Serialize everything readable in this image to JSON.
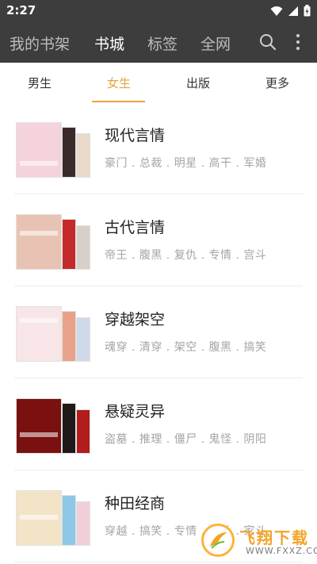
{
  "status_bar": {
    "time": "2:27"
  },
  "app_bar": {
    "tabs": [
      {
        "label": "我的书架",
        "active": false
      },
      {
        "label": "书城",
        "active": true
      },
      {
        "label": "标签",
        "active": false
      },
      {
        "label": "全网",
        "active": false
      }
    ],
    "actions": [
      "search-icon",
      "more-vert-icon"
    ]
  },
  "sub_tabs": [
    {
      "label": "男生",
      "active": false
    },
    {
      "label": "女生",
      "active": true
    },
    {
      "label": "出版",
      "active": false
    },
    {
      "label": "更多",
      "active": false
    }
  ],
  "categories": [
    {
      "title": "现代言情",
      "tags": "豪门 . 总裁 . 明星 . 高干 . 军婚",
      "cover_colors": [
        "#f4d3dc",
        "#3a2a2a",
        "#e9d9c9"
      ]
    },
    {
      "title": "古代言情",
      "tags": "帝王 . 腹黑 . 复仇 . 专情 . 宫斗",
      "cover_colors": [
        "#e8c3b3",
        "#c42a2a",
        "#d8d0c8"
      ]
    },
    {
      "title": "穿越架空",
      "tags": "魂穿 . 清穿 . 架空 . 腹黑 . 搞笑",
      "cover_colors": [
        "#f7e5e8",
        "#e9a28a",
        "#cfd9ea"
      ]
    },
    {
      "title": "悬疑灵异",
      "tags": "盗墓 . 推理 . 僵尸 . 鬼怪 . 阴阳",
      "cover_colors": [
        "#7a1010",
        "#1e1a1a",
        "#b11c1c"
      ]
    },
    {
      "title": "种田经商",
      "tags": "穿越 . 搞笑 . 专情 . 宅斗 . 家斗",
      "cover_colors": [
        "#f3e4c8",
        "#8fc7e6",
        "#f1cfd8"
      ]
    }
  ],
  "watermark": {
    "main": "飞翔下载",
    "sub": "WWW.FXXZ.COM"
  },
  "colors": {
    "bar": "#3d3d3d",
    "accent": "#e8a33d"
  }
}
